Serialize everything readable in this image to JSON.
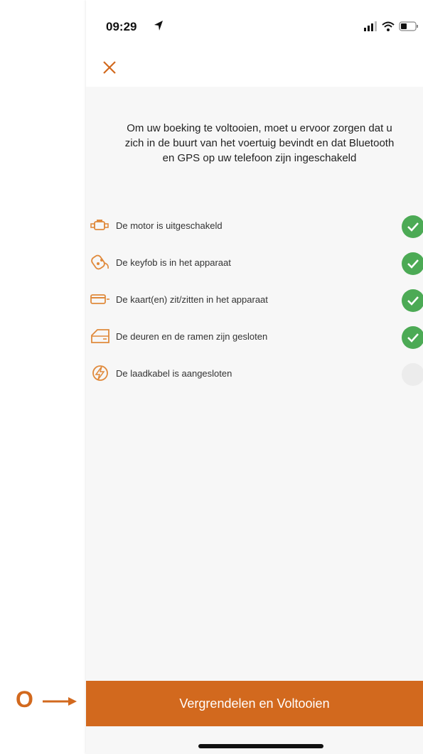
{
  "status_bar": {
    "time": "09:29",
    "icons": [
      "location-arrow-icon",
      "signal-icon",
      "wifi-icon",
      "battery-icon"
    ]
  },
  "nav": {
    "close_icon": "close-icon"
  },
  "message": "Om uw boeking te voltooien, moet u ervoor zorgen dat u zich in de buurt van het voertuig bevindt en dat Bluetooth en GPS op uw telefoon zijn ingeschakeld",
  "checklist": [
    {
      "label": "De motor is uitgeschakeld",
      "icon": "engine-icon",
      "status": "done"
    },
    {
      "label": "De keyfob is in het apparaat",
      "icon": "keyfob-icon",
      "status": "done"
    },
    {
      "label": "De kaart(en) zit/zitten in het apparaat",
      "icon": "card-icon",
      "status": "done"
    },
    {
      "label": "De deuren en de ramen zijn gesloten",
      "icon": "car-door-icon",
      "status": "done"
    },
    {
      "label": "De laadkabel is aangesloten",
      "icon": "charging-icon",
      "status": "pending"
    }
  ],
  "lock_button": "Vergrendelen en Voltooien",
  "annotation": {
    "letter": "O"
  },
  "colors": {
    "accent": "#d2691e",
    "done": "#4caa55",
    "pending": "#ececec"
  }
}
